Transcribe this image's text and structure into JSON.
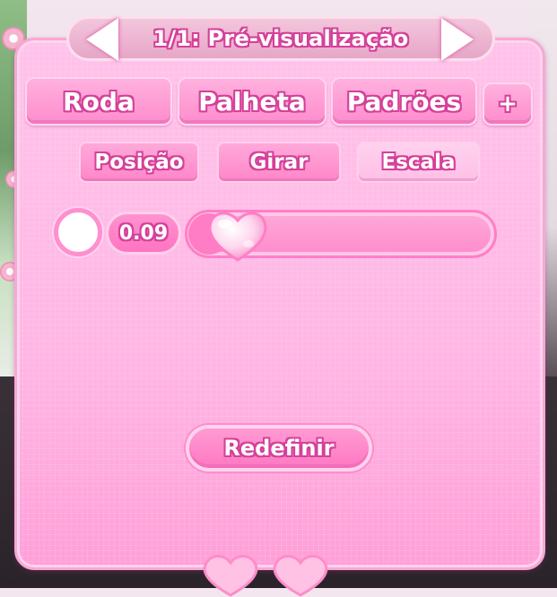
{
  "header": {
    "title": "1/1: Pré-visualização"
  },
  "tabs": [
    {
      "label": "Roda"
    },
    {
      "label": "Palheta"
    },
    {
      "label": "Padrões"
    },
    {
      "label": "+"
    }
  ],
  "subtabs": [
    {
      "label": "Posição"
    },
    {
      "label": "Girar"
    },
    {
      "label": "Escala",
      "active": true
    }
  ],
  "slider": {
    "value_label": "0.09",
    "value": 0.09
  },
  "reset": {
    "label": "Redefinir"
  },
  "colors": {
    "panel": "#ffb6e4",
    "accent": "#ff7dc4",
    "outline": "#d5409a"
  }
}
